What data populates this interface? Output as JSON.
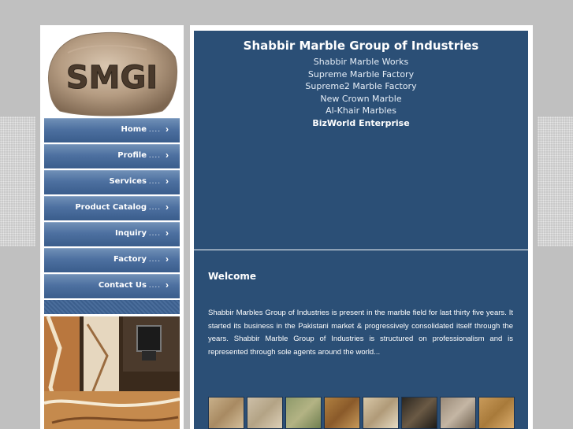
{
  "logo": {
    "text": "SMGI"
  },
  "nav": {
    "items": [
      {
        "label": "Home"
      },
      {
        "label": "Profile"
      },
      {
        "label": "Services"
      },
      {
        "label": "Product Catalog"
      },
      {
        "label": "Inquiry"
      },
      {
        "label": "Factory"
      },
      {
        "label": "Contact Us"
      }
    ],
    "dots": "....",
    "arrow": "›"
  },
  "header": {
    "title": "Shabbir Marble Group of Industries",
    "companies": [
      "Shabbir Marble Works",
      "Supreme Marble Factory",
      "Supreme2 Marble Factory",
      "New Crown Marble",
      "Al-Khair Marbles",
      "BizWorld Enterprise"
    ]
  },
  "content": {
    "welcome_title": "Welcome",
    "welcome_text": "Shabbir Marbles Group of Industries is present in the marble field for last thirty five years. It started its business in the Pakistani market & progressively consolidated itself through the years. Shabbir Marble Group of Industries is structured on professionalism and is represented through sole agents around the world..."
  },
  "colors": {
    "page_bg": "#c0c0c0",
    "panel_blue": "#2b4f76",
    "nav_blue": "#4d70a0"
  }
}
